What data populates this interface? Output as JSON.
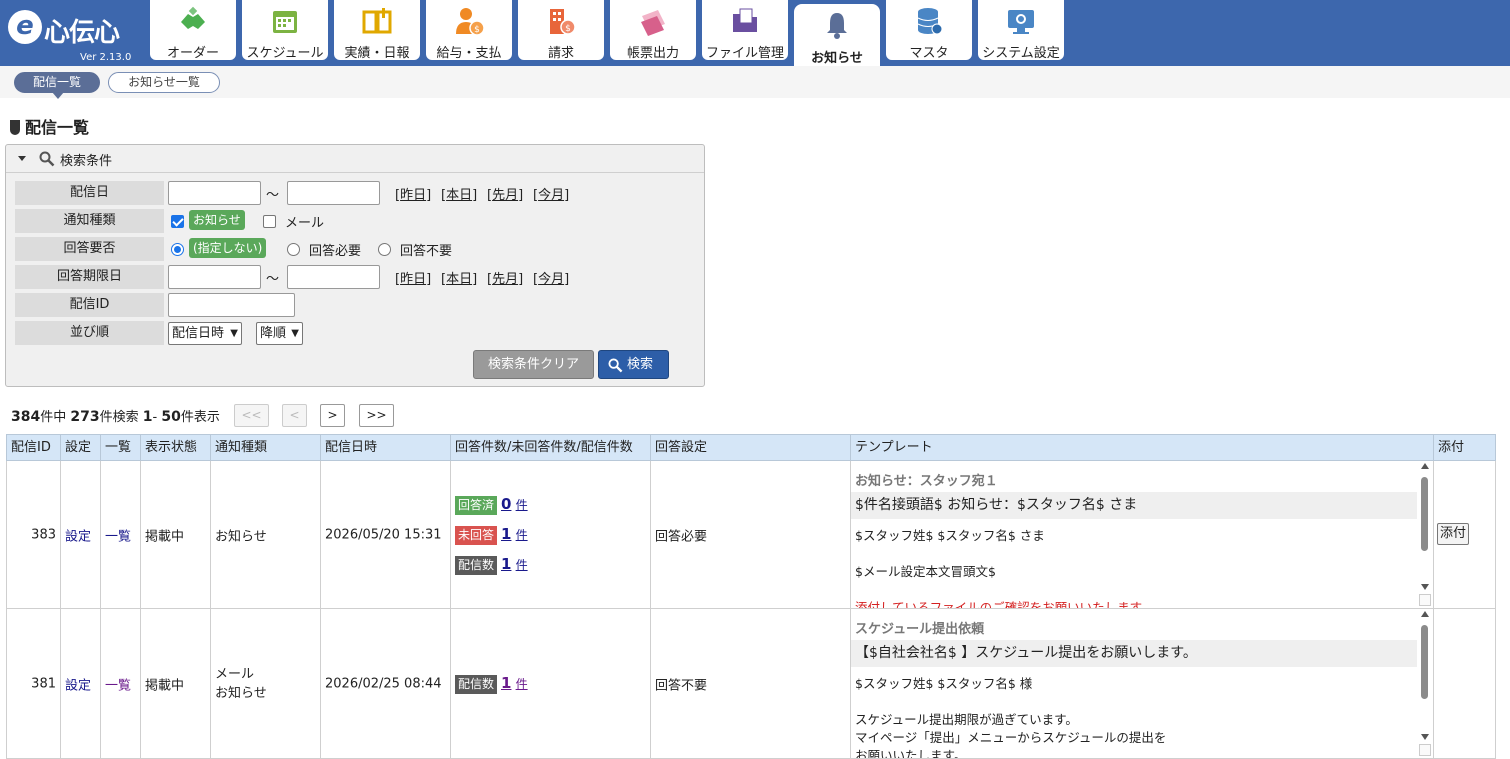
{
  "app": {
    "logo_text": "心伝心",
    "version": "Ver 2.13.0"
  },
  "tabs": [
    {
      "label": "オーダー",
      "icon": "handshake-icon",
      "color": "#4caf50"
    },
    {
      "label": "スケジュール",
      "icon": "calendar-icon",
      "color": "#7cb342"
    },
    {
      "label": "実績・日報",
      "icon": "book-icon",
      "color": "#e0a800"
    },
    {
      "label": "給与・支払",
      "icon": "person-coin-icon",
      "color": "#f08a24"
    },
    {
      "label": "請求",
      "icon": "building-coin-icon",
      "color": "#e8653a"
    },
    {
      "label": "帳票出力",
      "icon": "documents-icon",
      "color": "#d7608b"
    },
    {
      "label": "ファイル管理",
      "icon": "folder-icon",
      "color": "#6a4fa0"
    },
    {
      "label": "お知らせ",
      "icon": "bell-icon",
      "color": "#5b6e97"
    },
    {
      "label": "マスタ",
      "icon": "database-icon",
      "color": "#4a86c5"
    },
    {
      "label": "システム設定",
      "icon": "monitor-gear-icon",
      "color": "#4a86c5"
    }
  ],
  "subnav": {
    "active": "配信一覧",
    "other": "お知らせ一覧"
  },
  "page_title": "配信一覧",
  "search": {
    "header": "検索条件",
    "labels": {
      "date": "配信日",
      "type": "通知種類",
      "reply": "回答要否",
      "deadline": "回答期限日",
      "id": "配信ID",
      "order": "並び順"
    },
    "tilde": "～",
    "quick": [
      "昨日",
      "本日",
      "先月",
      "今月"
    ],
    "type_options": [
      {
        "label": "お知らせ",
        "checked": true
      },
      {
        "label": "メール",
        "checked": false
      }
    ],
    "reply_options": [
      {
        "label": "(指定しない)",
        "selected": true
      },
      {
        "label": "回答必要",
        "selected": false
      },
      {
        "label": "回答不要",
        "selected": false
      }
    ],
    "order_field": "配信日時",
    "order_dir": "降順",
    "clear_label": "検索条件クリア",
    "search_label": "検索"
  },
  "pager": {
    "total": "384",
    "total_unit": "件中",
    "found": "273",
    "found_unit": "件検索",
    "from": "1",
    "sep": "-",
    "to": "50",
    "to_unit": "件表示",
    "first": "<<",
    "prev": "<",
    "next": ">",
    "last": ">>"
  },
  "table": {
    "headers": [
      "配信ID",
      "設定",
      "一覧",
      "表示状態",
      "通知種類",
      "配信日時",
      "回答件数/未回答件数/配信件数",
      "回答設定",
      "テンプレート",
      "添付"
    ],
    "rows": [
      {
        "id": "383",
        "setting": "設定",
        "list": "一覧",
        "status": "掲載中",
        "types": [
          "お知らせ"
        ],
        "datetime": "2026/05/20 15:31",
        "counts": [
          {
            "badge": "回答済",
            "value": "0",
            "unit": "件",
            "color": "#5aa85a"
          },
          {
            "badge": "未回答",
            "value": "1",
            "unit": "件",
            "color": "#d9534f"
          },
          {
            "badge": "配信数",
            "value": "1",
            "unit": "件",
            "color": "#5a5a5a"
          }
        ],
        "reply": "回答必要",
        "template_title": "お知らせ：スタッフ宛１",
        "template_subject": "$件名接頭語$ お知らせ：$スタッフ名$ さま",
        "template_body": [
          "$スタッフ姓$ $スタッフ名$ さま",
          "",
          "$メール設定本文冒頭文$",
          "",
          ""
        ],
        "template_body_red": "添付しているファイルのご確認をお願いいたします。",
        "attach": "添付"
      },
      {
        "id": "381",
        "setting": "設定",
        "list": "一覧",
        "status": "掲載中",
        "types": [
          "メール",
          "お知らせ"
        ],
        "datetime": "2026/02/25 08:44",
        "counts": [
          {
            "badge": "配信数",
            "value": "1",
            "unit": "件",
            "color": "#5a5a5a"
          }
        ],
        "reply": "回答不要",
        "template_title": "スケジュール提出依頼",
        "template_subject": "【$自社会社名$ 】スケジュール提出をお願いします。",
        "template_body": [
          "$スタッフ姓$ $スタッフ名$ 様",
          "",
          "スケジュール提出期限が過ぎています。",
          "マイページ「提出」メニューからスケジュールの提出を",
          "お願いいたします。"
        ],
        "template_body_red": "",
        "attach": ""
      }
    ]
  }
}
